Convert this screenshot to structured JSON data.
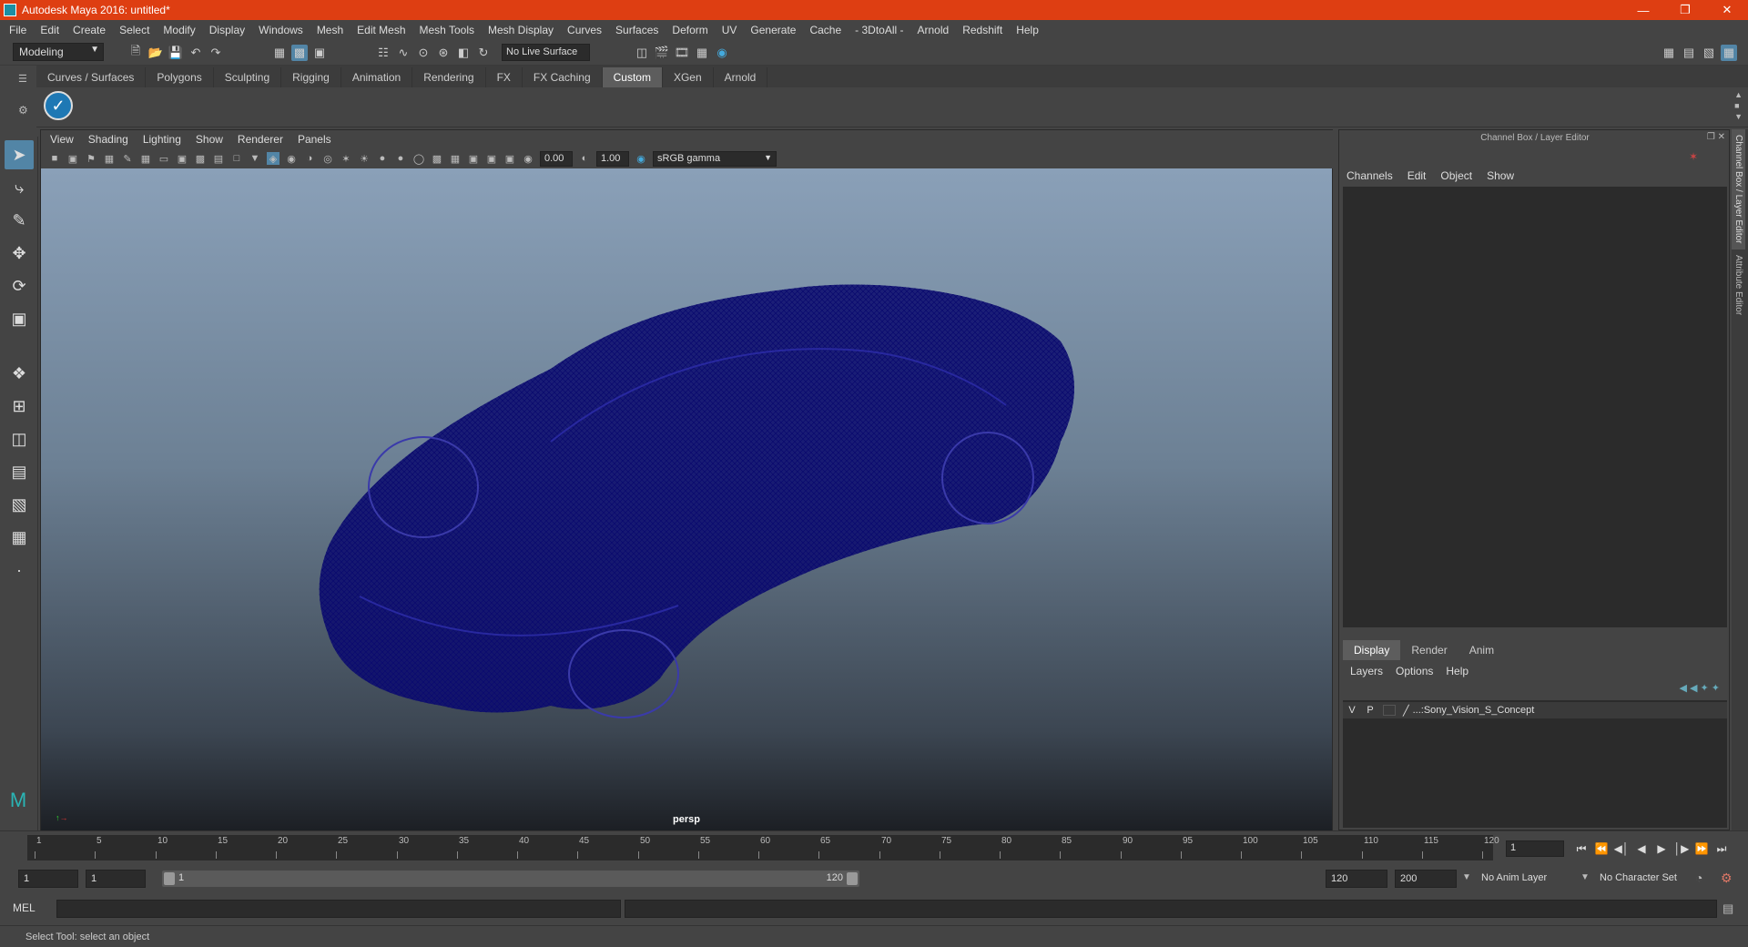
{
  "window": {
    "title": "Autodesk Maya 2016: untitled*",
    "title_color": "#de3e12"
  },
  "menubar": [
    "File",
    "Edit",
    "Create",
    "Select",
    "Modify",
    "Display",
    "Windows",
    "Mesh",
    "Edit Mesh",
    "Mesh Tools",
    "Mesh Display",
    "Curves",
    "Surfaces",
    "Deform",
    "UV",
    "Generate",
    "Cache",
    "- 3DtoAll -",
    "Arnold",
    "Redshift",
    "Help"
  ],
  "statusline": {
    "mode": "Modeling",
    "live_surface": "No Live Surface"
  },
  "shelf": {
    "tabs": [
      "Curves / Surfaces",
      "Polygons",
      "Sculpting",
      "Rigging",
      "Animation",
      "Rendering",
      "FX",
      "FX Caching",
      "Custom",
      "XGen",
      "Arnold"
    ],
    "active_tab": "Custom"
  },
  "panel": {
    "menu": [
      "View",
      "Shading",
      "Lighting",
      "Show",
      "Renderer",
      "Panels"
    ],
    "near_value": "0.00",
    "far_value": "1.00",
    "color_space": "sRGB gamma",
    "camera_label": "persp",
    "wireframe_color": "#0a0a6e"
  },
  "channel_box": {
    "title": "Channel Box / Layer Editor",
    "menu": [
      "Channels",
      "Edit",
      "Object",
      "Show"
    ],
    "layer_tabs": [
      "Display",
      "Render",
      "Anim"
    ],
    "active_layer_tab": "Display",
    "layer_menu": [
      "Layers",
      "Options",
      "Help"
    ],
    "layers": [
      {
        "v": "V",
        "p": "P",
        "name": "...:Sony_Vision_S_Concept"
      }
    ],
    "side_tabs": [
      "Channel Box / Layer Editor",
      "Attribute Editor"
    ]
  },
  "timeline": {
    "ticks": [
      "1",
      "5",
      "10",
      "15",
      "20",
      "25",
      "30",
      "35",
      "40",
      "45",
      "50",
      "55",
      "60",
      "65",
      "70",
      "75",
      "80",
      "85",
      "90",
      "95",
      "100",
      "105",
      "110",
      "115",
      "120"
    ],
    "current_frame": "1"
  },
  "range": {
    "start": "1",
    "playback_start": "1",
    "range_start_label": "1",
    "range_end_label": "120",
    "playback_end": "120",
    "end": "200",
    "anim_layer": "No Anim Layer",
    "character_set": "No Character Set"
  },
  "command_line": {
    "label": "MEL"
  },
  "help_line": {
    "text": "Select Tool: select an object"
  }
}
